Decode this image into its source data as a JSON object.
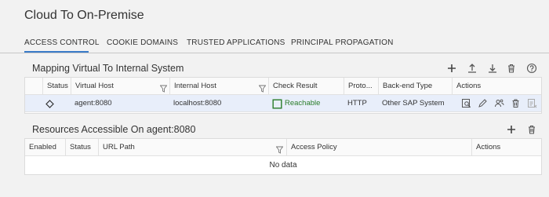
{
  "page": {
    "title": "Cloud To On-Premise"
  },
  "tabs": [
    {
      "label": "ACCESS CONTROL",
      "active": true
    },
    {
      "label": "COOKIE DOMAINS",
      "active": false
    },
    {
      "label": "TRUSTED APPLICATIONS",
      "active": false
    },
    {
      "label": "PRINCIPAL PROPAGATION",
      "active": false
    }
  ],
  "mapping": {
    "title": "Mapping Virtual To Internal System",
    "toolbar_icons": [
      "add-icon",
      "upload-icon",
      "download-icon",
      "delete-icon",
      "help-icon"
    ],
    "columns": [
      "Status",
      "Virtual Host",
      "Internal Host",
      "Check Result",
      "Proto...",
      "Back-end Type",
      "Actions"
    ],
    "rows": [
      {
        "status_icon": "diamond-icon",
        "virtual_host": "agent:8080",
        "internal_host": "localhost:8080",
        "check_result": "Reachable",
        "protocol": "HTTP",
        "backend_type": "Other SAP System",
        "actions": [
          "check-icon",
          "edit-icon",
          "assign-icon",
          "delete-icon",
          "disabled-icon"
        ]
      }
    ]
  },
  "resources": {
    "title": "Resources Accessible On agent:8080",
    "toolbar_icons": [
      "add-icon",
      "delete-icon"
    ],
    "columns": [
      "Enabled",
      "Status",
      "URL Path",
      "Access Policy",
      "Actions"
    ],
    "empty_text": "No data"
  },
  "colors": {
    "accent": "#3a7bc8",
    "reachable": "#2b7d2b",
    "selected_row": "#e8eefa",
    "icon": "#666666"
  }
}
